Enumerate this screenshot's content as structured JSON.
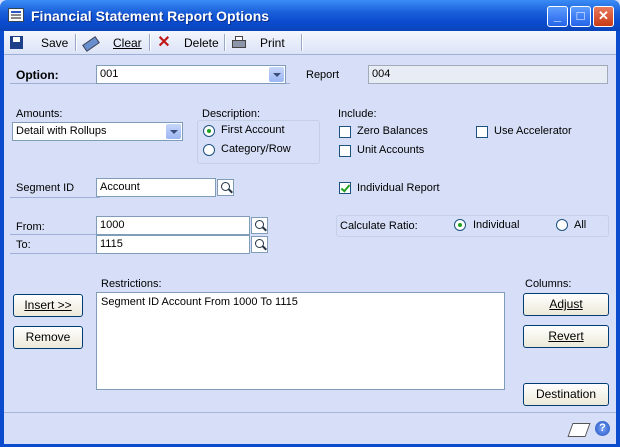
{
  "window": {
    "title": "Financial Statement Report Options"
  },
  "toolbar": {
    "save": "Save",
    "clear": "Clear",
    "delete": "Delete",
    "print": "Print"
  },
  "option": {
    "label": "Option:",
    "value": "001"
  },
  "report": {
    "label": "Report",
    "value": "004"
  },
  "amounts": {
    "label": "Amounts:",
    "value": "Detail with Rollups"
  },
  "description": {
    "label": "Description:",
    "first_account": "First Account",
    "category_row": "Category/Row",
    "selected": "First Account"
  },
  "include": {
    "label": "Include:",
    "zero_balances": "Zero Balances",
    "unit_accounts": "Unit Accounts",
    "use_accelerator": "Use Accelerator",
    "individual_report": "Individual Report"
  },
  "segment": {
    "label": "Segment ID",
    "value": "Account"
  },
  "calculate_ratio": {
    "label": "Calculate Ratio:",
    "individual": "Individual",
    "all": "All",
    "selected": "Individual"
  },
  "range": {
    "from_label": "From:",
    "from_value": "1000",
    "to_label": "To:",
    "to_value": "1115"
  },
  "restrictions": {
    "label": "Restrictions:",
    "items": [
      "Segment ID Account From 1000 To 1115"
    ]
  },
  "buttons": {
    "insert": "Insert >>",
    "remove": "Remove",
    "columns_label": "Columns:",
    "adjust": "Adjust",
    "revert": "Revert",
    "destination": "Destination"
  }
}
